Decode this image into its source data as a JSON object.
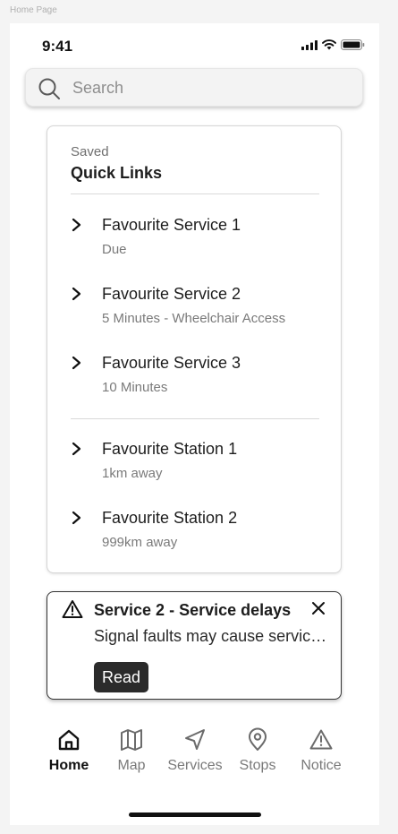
{
  "frame_label": "Home Page",
  "status_bar": {
    "time": "9:41"
  },
  "search": {
    "placeholder": "Search",
    "value": ""
  },
  "quick_links": {
    "kicker": "Saved",
    "title": "Quick Links",
    "services": [
      {
        "title": "Favourite Service 1",
        "subtitle": "Due"
      },
      {
        "title": "Favourite Service 2",
        "subtitle": "5 Minutes - Wheelchair Access"
      },
      {
        "title": "Favourite Service 3",
        "subtitle": "10 Minutes"
      }
    ],
    "stations": [
      {
        "title": "Favourite Station 1",
        "subtitle": "1km away"
      },
      {
        "title": "Favourite Station 2",
        "subtitle": "999km away"
      }
    ]
  },
  "notice": {
    "title": "Service 2 - Service delays",
    "body": "Signal faults may cause service disruptions",
    "button": "Read"
  },
  "tabs": [
    {
      "label": "Home",
      "icon": "home-icon",
      "active": true
    },
    {
      "label": "Map",
      "icon": "map-icon",
      "active": false
    },
    {
      "label": "Services",
      "icon": "navigation-icon",
      "active": false
    },
    {
      "label": "Stops",
      "icon": "map-pin-icon",
      "active": false
    },
    {
      "label": "Notice",
      "icon": "warning-icon",
      "active": false
    }
  ],
  "colors": {
    "accent_dark": "#2b2b2b",
    "background": "#f4f4f4",
    "surface": "#ffffff"
  }
}
